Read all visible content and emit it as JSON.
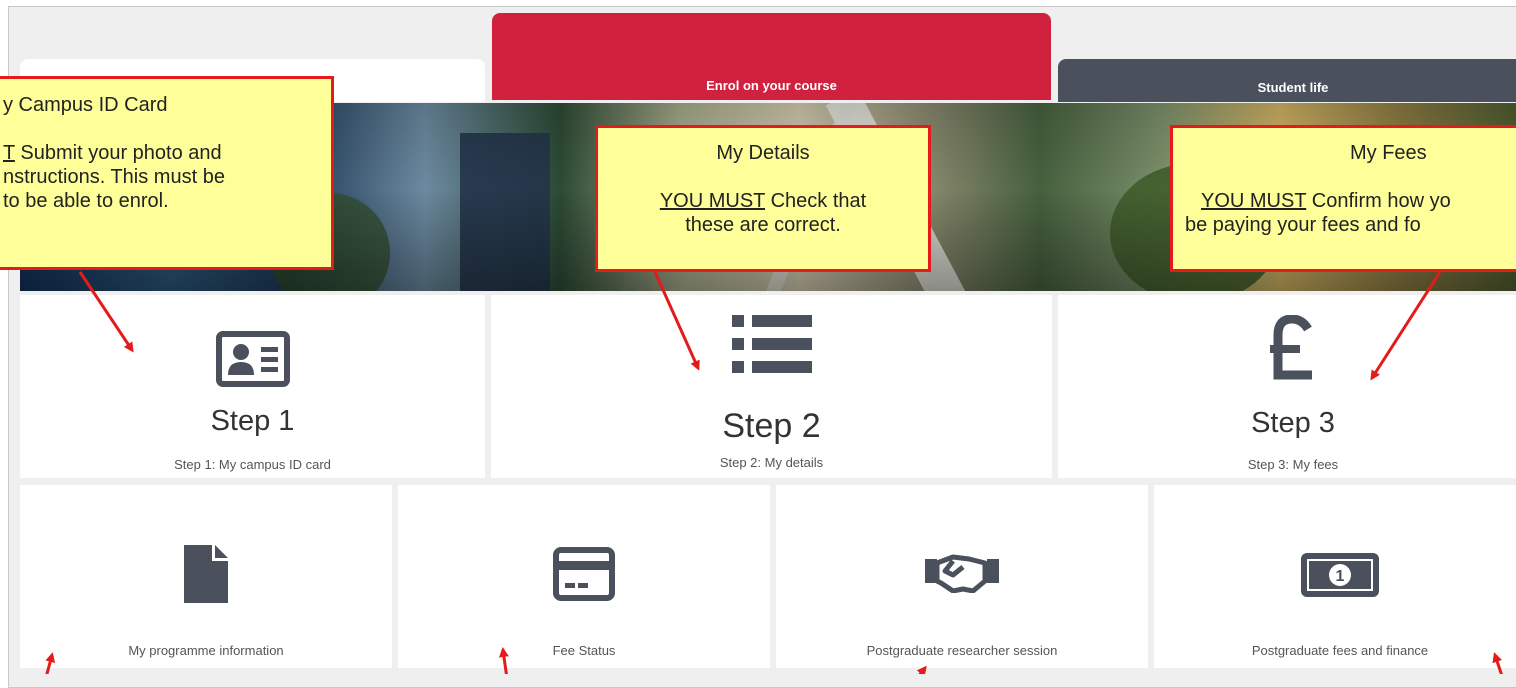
{
  "tabs": {
    "enrol_label": "Enrol on your course",
    "life_label": "Student life"
  },
  "steps": [
    {
      "title": "Step 1",
      "subtitle": "Step 1: My campus ID card",
      "icon": "id-card-icon"
    },
    {
      "title": "Step 2",
      "subtitle": "Step 2: My details",
      "icon": "list-icon"
    },
    {
      "title": "Step 3",
      "subtitle": "Step 3: My fees",
      "icon": "pound-icon"
    }
  ],
  "tiles": [
    {
      "label": "My programme information",
      "icon": "document-icon"
    },
    {
      "label": "Fee Status",
      "icon": "credit-card-icon"
    },
    {
      "label": "Postgraduate researcher session",
      "icon": "handshake-icon"
    },
    {
      "label": "Postgraduate fees and finance",
      "icon": "banknote-icon"
    }
  ],
  "notes": {
    "campus": {
      "line1": "y Campus ID Card",
      "line2_prefix": "T",
      "line2_rest": " Submit your photo and",
      "line3": "nstructions. This must be",
      "line4": "to be able to enrol."
    },
    "details": {
      "title": "My Details",
      "must": "YOU MUST",
      "line1_rest": " Check that",
      "line2": "these are correct."
    },
    "fees": {
      "title": "My Fees",
      "must": "YOU MUST",
      "line1_rest": " Confirm how yo",
      "line2": "be paying your fees and fo"
    }
  },
  "colors": {
    "enrol_tab": "#d0223f",
    "life_tab": "#4a505c",
    "note_fill": "#ffff99",
    "note_border": "#e31b1b",
    "icon": "#4a505c"
  }
}
